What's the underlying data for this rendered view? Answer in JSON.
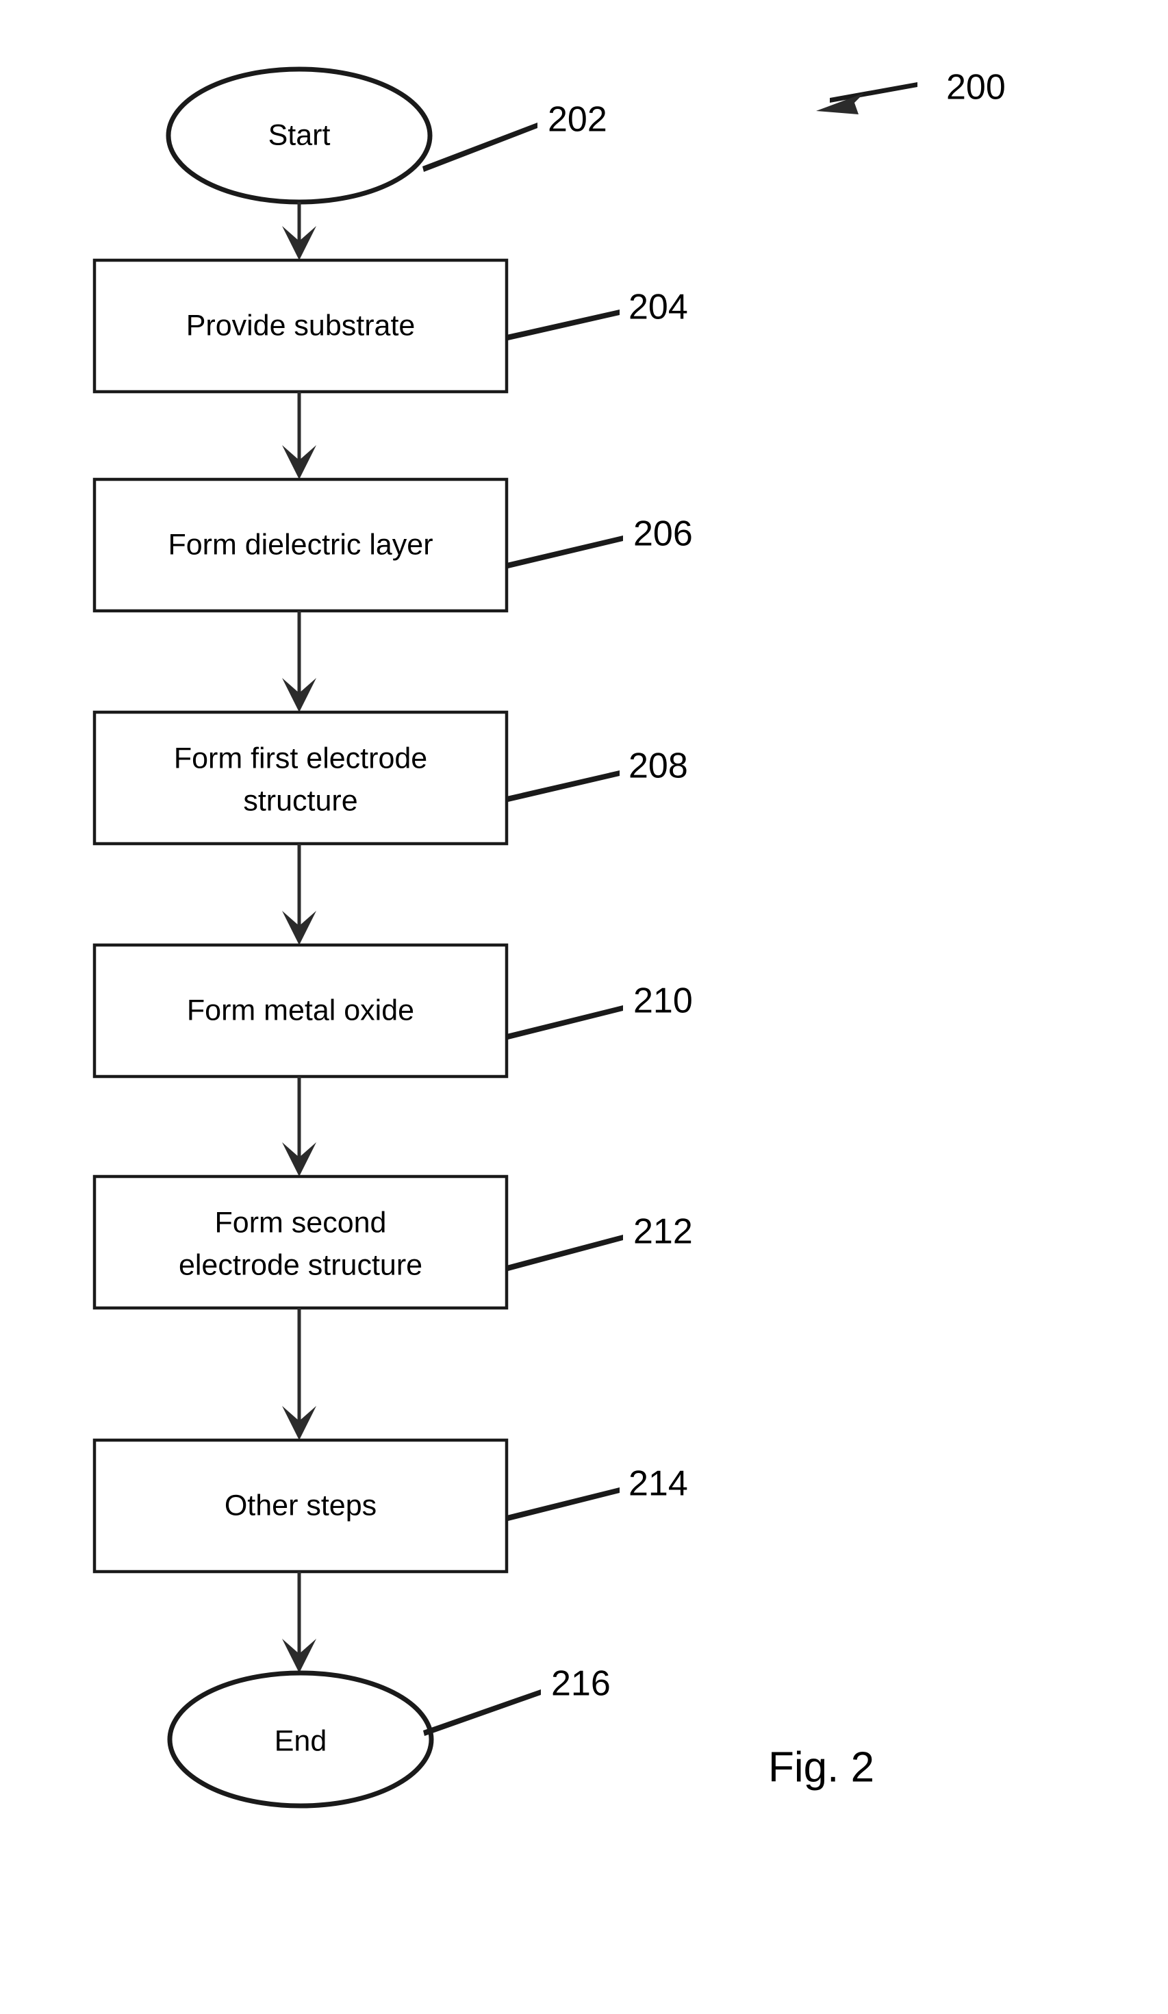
{
  "figure": {
    "caption": "Fig. 2",
    "overall_ref": "200",
    "background_color": "#ffffff",
    "stroke_color": "#1a1a1a"
  },
  "nodes": [
    {
      "id": "start",
      "kind": "terminator",
      "label": "Start",
      "label_line_1": "Start",
      "label_line_2": "",
      "ref": "202"
    },
    {
      "id": "provide-substrate",
      "kind": "process",
      "label": "Provide substrate",
      "label_line_1": "Provide substrate",
      "label_line_2": "",
      "ref": "204"
    },
    {
      "id": "form-dielectric-layer",
      "kind": "process",
      "label": "Form dielectric layer",
      "label_line_1": "Form dielectric layer",
      "label_line_2": "",
      "ref": "206"
    },
    {
      "id": "form-first-electrode-structure",
      "kind": "process",
      "label": "Form first electrode structure",
      "label_line_1": "Form first electrode",
      "label_line_2": "structure",
      "ref": "208"
    },
    {
      "id": "form-metal-oxide",
      "kind": "process",
      "label": "Form metal oxide",
      "label_line_1": "Form metal oxide",
      "label_line_2": "",
      "ref": "210"
    },
    {
      "id": "form-second-electrode-structure",
      "kind": "process",
      "label": "Form second electrode structure",
      "label_line_1": "Form second",
      "label_line_2": "electrode structure",
      "ref": "212"
    },
    {
      "id": "other-steps",
      "kind": "process",
      "label": "Other steps",
      "label_line_1": "Other steps",
      "label_line_2": "",
      "ref": "214"
    },
    {
      "id": "end",
      "kind": "terminator",
      "label": "End",
      "label_line_1": "End",
      "label_line_2": "",
      "ref": "216"
    }
  ],
  "connections": [
    {
      "from": "start",
      "to": "provide-substrate"
    },
    {
      "from": "provide-substrate",
      "to": "form-dielectric-layer"
    },
    {
      "from": "form-dielectric-layer",
      "to": "form-first-electrode-structure"
    },
    {
      "from": "form-first-electrode-structure",
      "to": "form-metal-oxide"
    },
    {
      "from": "form-metal-oxide",
      "to": "form-second-electrode-structure"
    },
    {
      "from": "form-second-electrode-structure",
      "to": "other-steps"
    },
    {
      "from": "other-steps",
      "to": "end"
    }
  ]
}
